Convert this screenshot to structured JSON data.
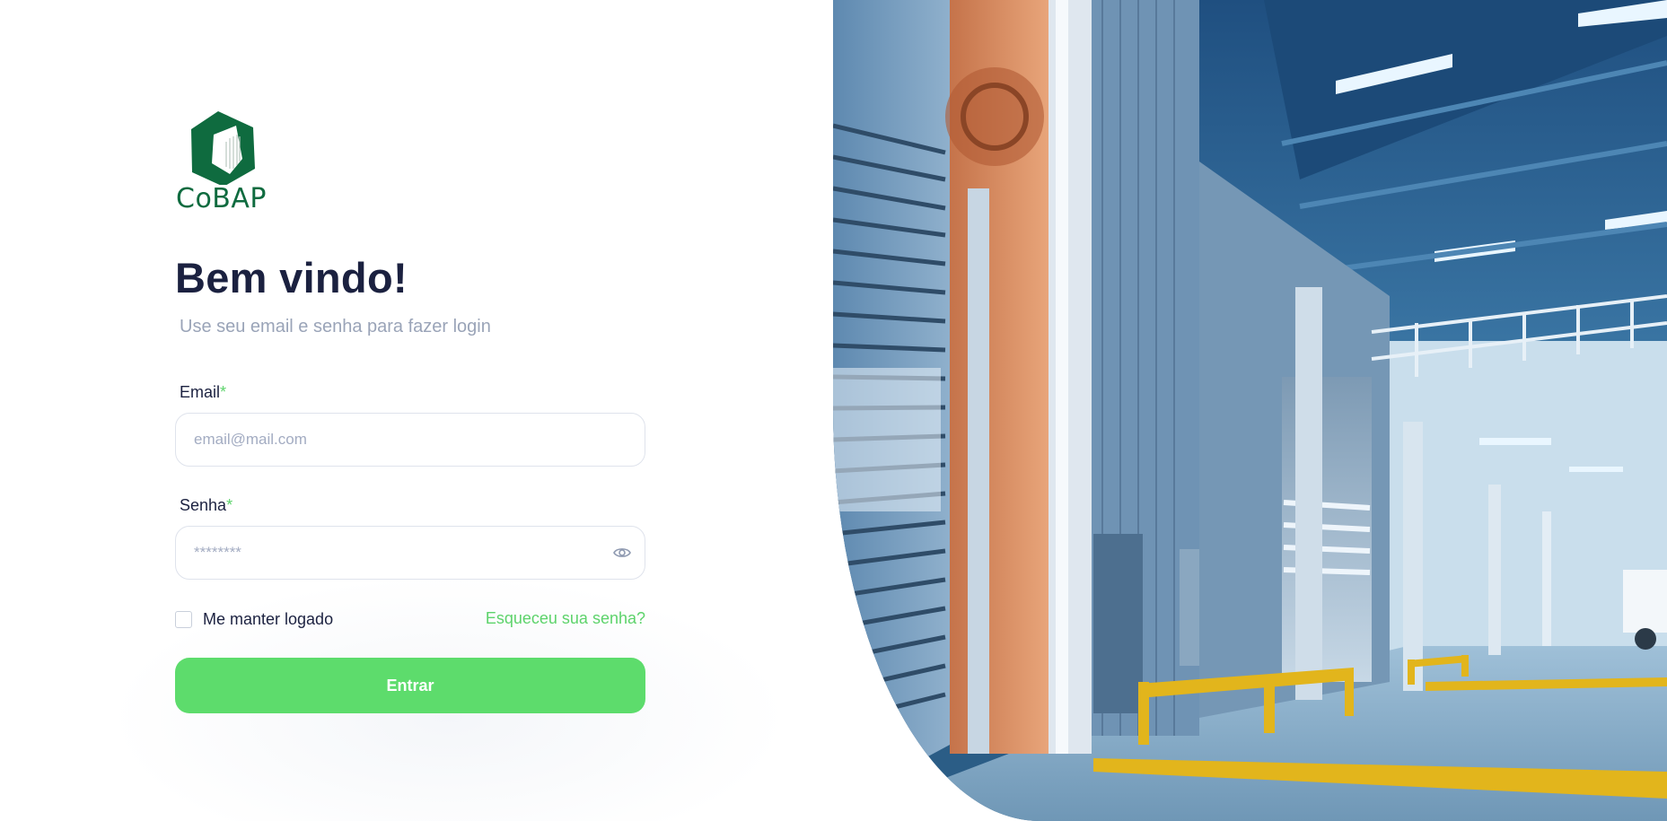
{
  "brand": {
    "name": "CoBAP",
    "color": "#0f6b3f"
  },
  "login": {
    "title": "Bem vindo!",
    "subtitle": "Use seu email e senha para fazer login",
    "email": {
      "label": "Email",
      "required_mark": "*",
      "placeholder": "email@mail.com",
      "value": ""
    },
    "password": {
      "label": "Senha",
      "required_mark": "*",
      "placeholder": "********",
      "value": ""
    },
    "remember_label": "Me manter logado",
    "remember_checked": false,
    "forgot_label": "Esqueceu sua senha?",
    "submit_label": "Entrar"
  },
  "colors": {
    "accent": "#5ddc6c",
    "title": "#1b2140",
    "muted": "#9aa4b8"
  },
  "icons": {
    "password_toggle": "eye-icon"
  }
}
